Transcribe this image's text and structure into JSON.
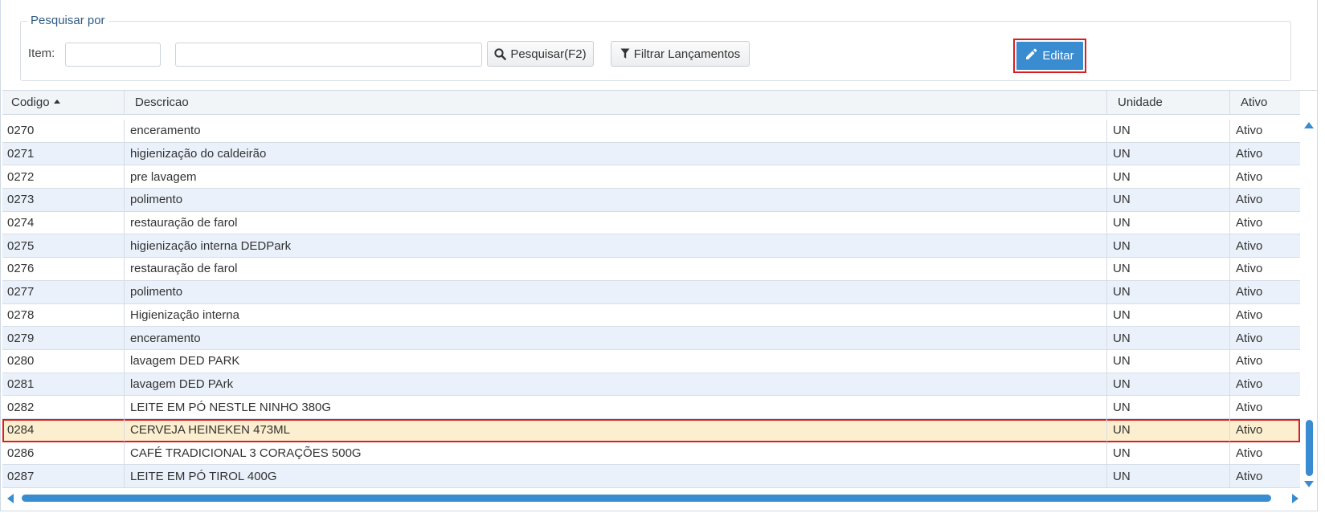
{
  "search": {
    "legend": "Pesquisar por",
    "item_label": "Item:",
    "item_code_value": "",
    "item_desc_value": "",
    "search_button": "Pesquisar(F2)",
    "filter_button": "Filtrar Lançamentos",
    "edit_button": "Editar"
  },
  "grid": {
    "columns": [
      "Codigo",
      "Descricao",
      "Unidade",
      "Ativo"
    ],
    "sort_column": "Codigo",
    "sort_direction": "ascending",
    "rows": [
      {
        "codigo": "0270",
        "descricao": "enceramento",
        "unidade": "UN",
        "ativo": "Ativo"
      },
      {
        "codigo": "0271",
        "descricao": "higienização do caldeirão",
        "unidade": "UN",
        "ativo": "Ativo"
      },
      {
        "codigo": "0272",
        "descricao": "pre lavagem",
        "unidade": "UN",
        "ativo": "Ativo"
      },
      {
        "codigo": "0273",
        "descricao": "polimento",
        "unidade": "UN",
        "ativo": "Ativo"
      },
      {
        "codigo": "0274",
        "descricao": "restauração de farol",
        "unidade": "UN",
        "ativo": "Ativo"
      },
      {
        "codigo": "0275",
        "descricao": "higienização interna DEDPark",
        "unidade": "UN",
        "ativo": "Ativo"
      },
      {
        "codigo": "0276",
        "descricao": "restauração de farol",
        "unidade": "UN",
        "ativo": "Ativo"
      },
      {
        "codigo": "0277",
        "descricao": "polimento",
        "unidade": "UN",
        "ativo": "Ativo"
      },
      {
        "codigo": "0278",
        "descricao": "Higienização interna",
        "unidade": "UN",
        "ativo": "Ativo"
      },
      {
        "codigo": "0279",
        "descricao": "enceramento",
        "unidade": "UN",
        "ativo": "Ativo"
      },
      {
        "codigo": "0280",
        "descricao": "lavagem DED PARK",
        "unidade": "UN",
        "ativo": "Ativo"
      },
      {
        "codigo": "0281",
        "descricao": "lavagem DED PArk",
        "unidade": "UN",
        "ativo": "Ativo"
      },
      {
        "codigo": "0282",
        "descricao": "LEITE EM PÓ NESTLE NINHO 380G",
        "unidade": "UN",
        "ativo": "Ativo"
      },
      {
        "codigo": "0284",
        "descricao": "CERVEJA HEINEKEN 473ML",
        "unidade": "UN",
        "ativo": "Ativo",
        "selected": true
      },
      {
        "codigo": "0286",
        "descricao": "CAFÉ TRADICIONAL 3 CORAÇÕES 500G",
        "unidade": "UN",
        "ativo": "Ativo"
      },
      {
        "codigo": "0287",
        "descricao": "LEITE EM PÓ TIROL 400G",
        "unidade": "UN",
        "ativo": "Ativo"
      }
    ]
  },
  "colors": {
    "accent": "#3a8cd0",
    "highlight_border": "#d81e24",
    "selected_row": "#fcefcf",
    "alt_row": "#eaf1fa"
  },
  "icons": {
    "search": "magnifier-icon",
    "filter": "funnel-icon",
    "edit": "pencil-icon"
  }
}
